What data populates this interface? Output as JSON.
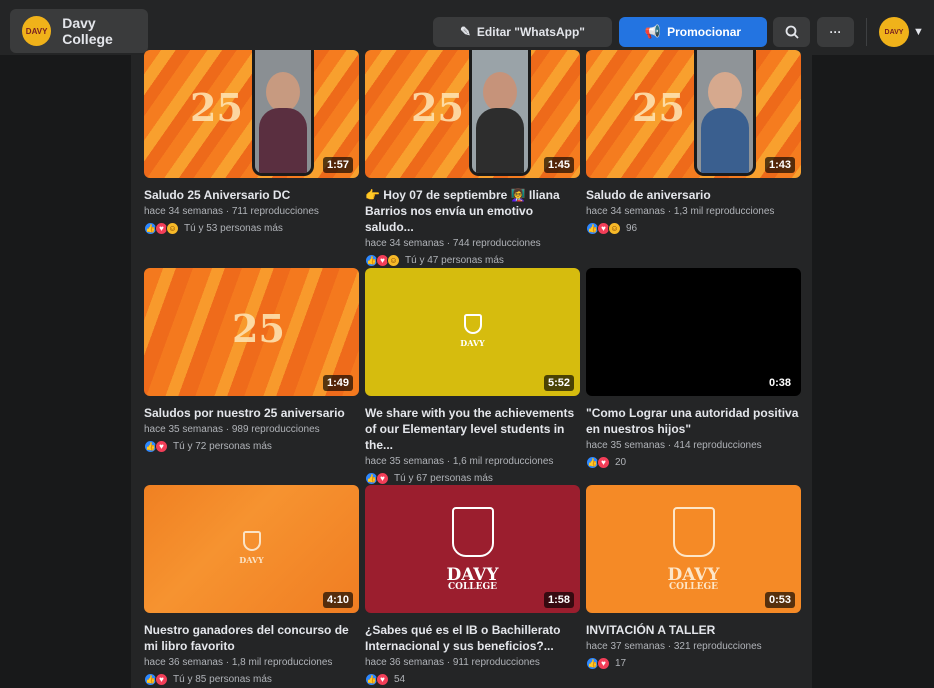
{
  "header": {
    "page_name": "Davy College",
    "logo_text": "DAVY",
    "edit_button": "Editar \"WhatsApp\"",
    "promote_button": "Promocionar",
    "search_icon": "search-icon",
    "more_icon": "more-icon",
    "avatar_text": "DAVY"
  },
  "videos": [
    {
      "title": "Saludo 25 Aniversario DC",
      "meta": "hace 34 semanas · 711 reproducciones",
      "reactions": "Tú y 53 personas más",
      "duration": "1:57",
      "big_text": "25"
    },
    {
      "title": "👉 Hoy 07 de septiembre 👩‍🏫 Iliana Barrios nos envía un emotivo saludo...",
      "meta": "hace 34 semanas · 744 reproducciones",
      "reactions": "Tú y 47 personas más",
      "duration": "1:45",
      "big_text": "25"
    },
    {
      "title": "Saludo de aniversario",
      "meta": "hace 34 semanas · 1,3 mil reproducciones",
      "reactions": "96",
      "duration": "1:43",
      "big_text": "25"
    },
    {
      "title": "Saludos por nuestro 25 aniversario",
      "meta": "hace 35 semanas · 989 reproducciones",
      "reactions": "Tú y 72 personas más",
      "duration": "1:49",
      "big_text": "25"
    },
    {
      "title": "We share with you the achievements of our Elementary level students in the...",
      "meta": "hace 35 semanas · 1,6 mil reproducciones",
      "reactions": "Tú y 67 personas más",
      "duration": "5:52",
      "crest_text": "DAVY"
    },
    {
      "title": "\"Como Lograr una autoridad positiva en nuestros hijos\"",
      "meta": "hace 35 semanas · 414 reproducciones",
      "reactions": "20",
      "duration": "0:38"
    },
    {
      "title": "Nuestro ganadores del concurso de mi libro favorito",
      "meta": "hace 36 semanas · 1,8 mil reproducciones",
      "reactions": "Tú y 85 personas más",
      "duration": "4:10",
      "crest_text": "DAVY"
    },
    {
      "title": "¿Sabes qué es el IB o Bachillerato Internacional y sus beneficios?...",
      "meta": "hace 36 semanas · 911 reproducciones",
      "reactions": "54",
      "duration": "1:58",
      "crest_text": "DAVY",
      "crest_sub": "COLLEGE"
    },
    {
      "title": "INVITACIÓN A TALLER",
      "meta": "hace 37 semanas · 321 reproducciones",
      "reactions": "17",
      "duration": "0:53",
      "crest_text": "DAVY",
      "crest_sub": "COLLEGE"
    }
  ],
  "colors": {
    "accent": "#2374e1",
    "like": "#2d88ff",
    "love": "#f33e58",
    "care": "#f7b928"
  }
}
